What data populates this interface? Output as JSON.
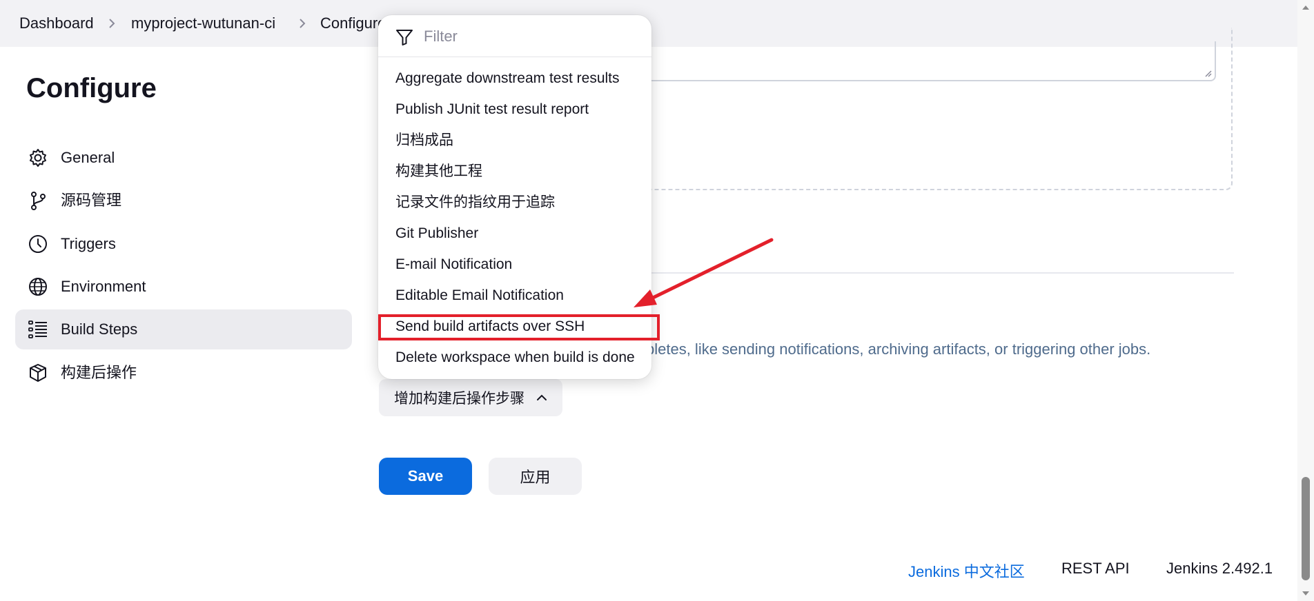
{
  "breadcrumb": {
    "items": [
      "Dashboard",
      "myproject-wutunan-ci",
      "Configure"
    ]
  },
  "sidebar": {
    "title": "Configure",
    "items": [
      {
        "label": "General",
        "icon": "gear-icon"
      },
      {
        "label": "源码管理",
        "icon": "branch-icon"
      },
      {
        "label": "Triggers",
        "icon": "clock-icon"
      },
      {
        "label": "Environment",
        "icon": "globe-icon"
      },
      {
        "label": "Build Steps",
        "icon": "list-icon",
        "active": true
      },
      {
        "label": "构建后操作",
        "icon": "package-icon"
      }
    ]
  },
  "main": {
    "hint_text": "pletes, like sending notifications, archiving artifacts, or triggering other jobs.",
    "add_step_label": "增加构建后操作步骤",
    "save_label": "Save",
    "apply_label": "应用"
  },
  "dropdown": {
    "filter_placeholder": "Filter",
    "items": [
      "Aggregate downstream test results",
      "Publish JUnit test result report",
      "归档成品",
      "构建其他工程",
      "记录文件的指纹用于追踪",
      "Git Publisher",
      "E-mail Notification",
      "Editable Email Notification",
      "Send build artifacts over SSH",
      "Delete workspace when build is done"
    ],
    "highlighted_index": 8
  },
  "footer": {
    "community_label": "Jenkins 中文社区",
    "rest_api_label": "REST API",
    "version_label": "Jenkins 2.492.1"
  },
  "colors": {
    "accent": "#0b6bde",
    "annotation": "#e3202b",
    "topbar": "#f2f2f5"
  }
}
